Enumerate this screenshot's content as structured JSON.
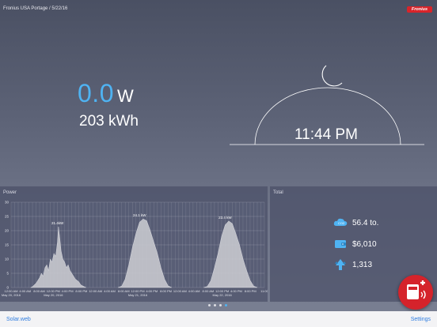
{
  "header": {
    "location": "Fronius USA Portage / 5/22/16",
    "brand": "Fronius"
  },
  "current": {
    "power_value": "0.0",
    "power_unit": "W",
    "energy_total": "203 kWh",
    "time": "11:44 PM"
  },
  "power_panel": {
    "title": "Power",
    "chart_data": {
      "type": "area",
      "x_ticks": [
        "12:00 AM\nMay 20, 2016",
        "4:00 AM",
        "8:00 AM",
        "12:00 PM\nMay 20, 2016",
        "4:00 PM",
        "8:00 PM",
        "12:00 AM",
        "4:00 AM",
        "8:00 AM",
        "12:00 PM\nMay 21, 2016",
        "4:00 PM",
        "8:00 PM",
        "12:00 AM",
        "4:00 AM",
        "8:00 AM",
        "12:00 PM\nMay 22, 2016",
        "4:00 PM",
        "8:00 PM",
        "11:00"
      ],
      "y_ticks": [
        "0",
        "5",
        "10",
        "15",
        "20",
        "25",
        "30"
      ],
      "ylim": [
        0,
        30
      ],
      "xlim_hours": [
        0,
        71
      ],
      "peak_labels": [
        {
          "text": "21.4kW",
          "x_hours": 13,
          "y": 21.4
        },
        {
          "text": "24.1 kW",
          "x_hours": 36,
          "y": 24.1
        },
        {
          "text": "23.4 kW",
          "x_hours": 60,
          "y": 23.4
        }
      ],
      "series": [
        {
          "color": "#c7c8ce",
          "x": [
            5.5,
            6,
            7,
            8,
            8.5,
            9,
            9.5,
            10,
            10.5,
            11,
            11.5,
            12,
            12.5,
            13,
            13.3,
            13.6,
            14,
            14.5,
            15,
            15.5,
            16,
            16.5,
            17,
            17.5,
            18,
            18.5,
            19,
            19.5,
            20,
            20.5,
            21,
            30,
            31,
            32,
            33,
            34,
            35,
            36,
            37,
            38,
            39,
            40,
            41,
            42,
            43,
            44,
            45,
            54,
            55,
            56,
            57,
            58,
            59,
            60,
            61,
            62,
            63,
            64,
            65,
            66,
            67,
            68,
            69
          ],
          "y": [
            0,
            0.3,
            1.5,
            3.5,
            5,
            4,
            7,
            8,
            6,
            10,
            9,
            12,
            11,
            16,
            21.4,
            18,
            13,
            10,
            9,
            7,
            8,
            6,
            5,
            4,
            3,
            2.5,
            2,
            1,
            0.6,
            0.3,
            0,
            0,
            0.5,
            3,
            8,
            14,
            19,
            23,
            24.1,
            23.5,
            20,
            16,
            12,
            7,
            3,
            0.6,
            0,
            0,
            0.4,
            2.5,
            7,
            12,
            18,
            22,
            23.4,
            22.5,
            19,
            15,
            10,
            6,
            2.5,
            0.5,
            0
          ]
        }
      ]
    }
  },
  "total_panel": {
    "title": "Total",
    "co2": "56.4 to.",
    "earnings": "$6,010",
    "trees": "1,313"
  },
  "pager": {
    "count": 4,
    "active_index": 3
  },
  "footer": {
    "left_link": "Solar.web",
    "right_link": "Settings"
  },
  "colors": {
    "accent": "#4fb3f2",
    "brand_red": "#d5232b",
    "link": "#2f7de0"
  },
  "icons": {
    "moon": "moon-icon",
    "co2": "co2-cloud-icon",
    "earnings": "wallet-icon",
    "trees": "tree-icon",
    "fab": "inverter-add-icon"
  }
}
